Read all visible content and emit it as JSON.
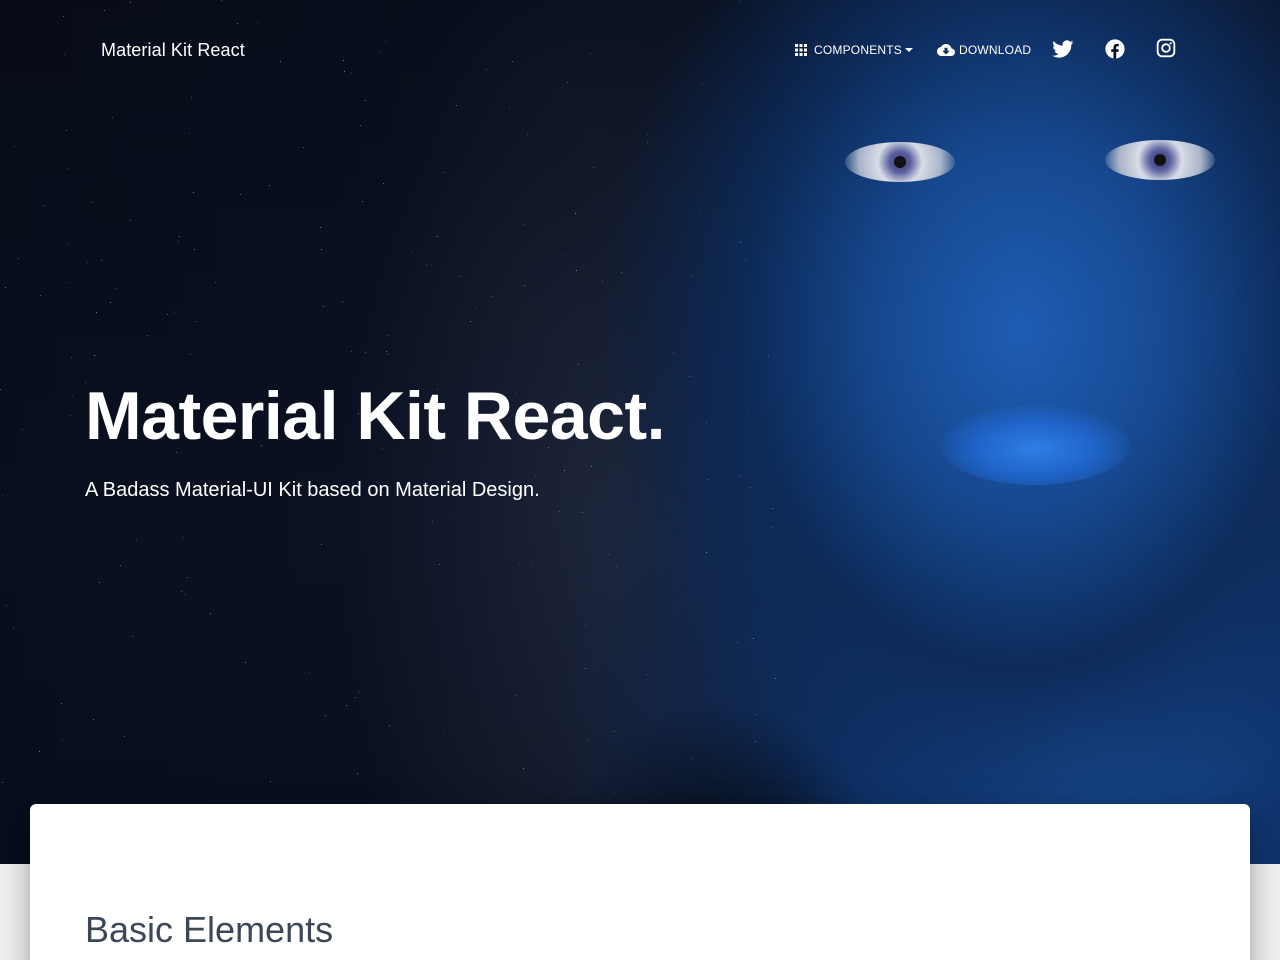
{
  "navbar": {
    "brand": "Material Kit React",
    "components_label": "Components",
    "download_label": "Download"
  },
  "icons": {
    "components": "apps-grid-icon",
    "dropdown": "caret-down-icon",
    "download": "cloud-download-icon",
    "twitter": "twitter-icon",
    "facebook": "facebook-icon",
    "instagram": "instagram-icon"
  },
  "hero": {
    "title": "Material Kit React.",
    "subtitle": "A Badass Material-UI Kit based on Material Design."
  },
  "main": {
    "section_title": "Basic Elements"
  },
  "colors": {
    "hero_dark": "#0b1224",
    "accent_blue": "#1f5fb8",
    "card": "#ffffff",
    "heading": "#3c4858"
  }
}
